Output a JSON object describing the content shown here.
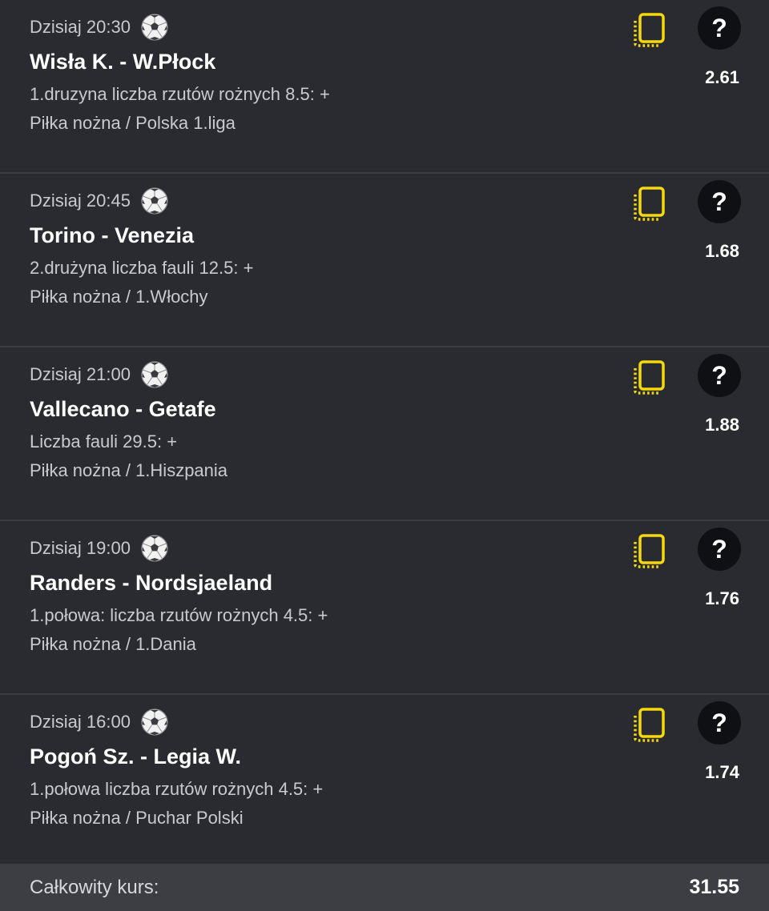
{
  "bets": [
    {
      "time": "Dzisiaj 20:30",
      "sport_icon": "soccer-ball-icon",
      "match": "Wisła K. - W.Płock",
      "market": "1.druzyna liczba rzutów rożnych 8.5: +",
      "league": "Piłka nożna / Polska 1.liga",
      "odds": "2.61",
      "help_label": "?"
    },
    {
      "time": "Dzisiaj 20:45",
      "sport_icon": "soccer-ball-icon",
      "match": "Torino - Venezia",
      "market": "2.drużyna liczba fauli 12.5: +",
      "league": "Piłka nożna / 1.Włochy",
      "odds": "1.68",
      "help_label": "?"
    },
    {
      "time": "Dzisiaj 21:00",
      "sport_icon": "soccer-ball-icon",
      "match": "Vallecano - Getafe",
      "market": "Liczba fauli 29.5: +",
      "league": "Piłka nożna / 1.Hiszpania",
      "odds": "1.88",
      "help_label": "?"
    },
    {
      "time": "Dzisiaj 19:00",
      "sport_icon": "soccer-ball-icon",
      "match": "Randers - Nordsjaeland",
      "market": "1.połowa: liczba rzutów rożnych 4.5: +",
      "league": "Piłka nożna / 1.Dania",
      "odds": "1.76",
      "help_label": "?"
    },
    {
      "time": "Dzisiaj 16:00",
      "sport_icon": "soccer-ball-icon",
      "match": "Pogoń Sz. - Legia W.",
      "market": "1.połowa liczba rzutów rożnych 4.5: +",
      "league": "Piłka nożna / Puchar Polski",
      "odds": "1.74",
      "help_label": "?"
    }
  ],
  "total": {
    "label": "Całkowity kurs:",
    "value": "31.55"
  },
  "colors": {
    "background": "#2a2b30",
    "divider": "#3c3d43",
    "accent_yellow": "#f5d90a",
    "total_bar": "#3d3e44",
    "help_button": "#0f1013"
  }
}
